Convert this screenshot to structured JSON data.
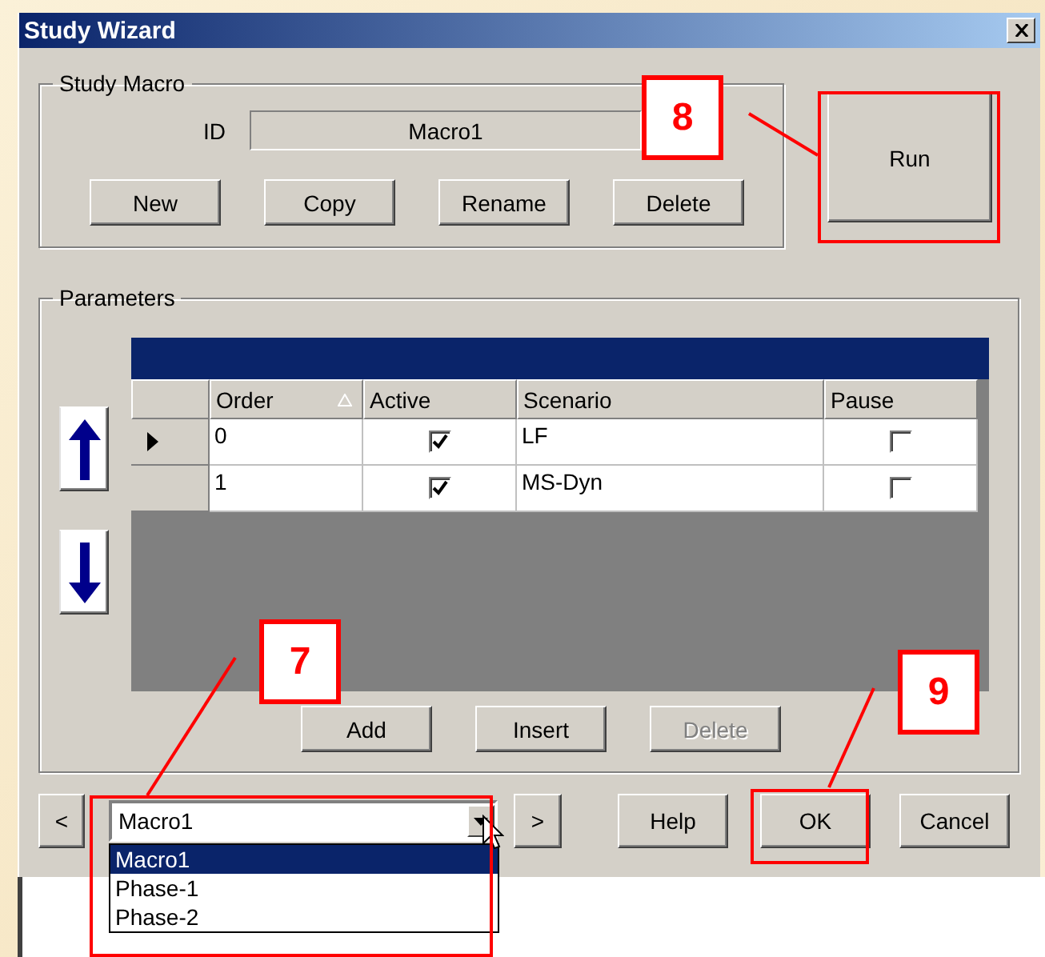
{
  "window": {
    "title": "Study Wizard"
  },
  "study_macro": {
    "label": "Study Macro",
    "id_label": "ID",
    "id_value": "Macro1",
    "buttons": [
      {
        "label": "New",
        "disabled": false
      },
      {
        "label": "Copy",
        "disabled": false
      },
      {
        "label": "Rename",
        "disabled": false
      },
      {
        "label": "Delete",
        "disabled": false
      }
    ]
  },
  "run_button": {
    "label": "Run"
  },
  "parameters": {
    "label": "Parameters",
    "columns": [
      {
        "label": "Order",
        "sorted": true
      },
      {
        "label": "Active",
        "sorted": false
      },
      {
        "label": "Scenario",
        "sorted": false
      },
      {
        "label": "Pause",
        "sorted": false
      }
    ],
    "rows": [
      {
        "current": true,
        "order": "0",
        "active": true,
        "scenario": "LF",
        "pause": false
      },
      {
        "current": false,
        "order": "1",
        "active": true,
        "scenario": "MS-Dyn",
        "pause": false
      }
    ],
    "buttons": [
      {
        "label": "Add",
        "disabled": false
      },
      {
        "label": "Insert",
        "disabled": false
      },
      {
        "label": "Delete",
        "disabled": true
      }
    ]
  },
  "nav": {
    "prev": "<",
    "next": ">"
  },
  "combo": {
    "value": "Macro1",
    "options": [
      {
        "label": "Macro1",
        "selected": true
      },
      {
        "label": "Phase-1",
        "selected": false
      },
      {
        "label": "Phase-2",
        "selected": false
      }
    ]
  },
  "buttons": [
    {
      "label": "Help"
    },
    {
      "label": "OK"
    },
    {
      "label": "Cancel"
    }
  ],
  "callouts": [
    {
      "label": "7"
    },
    {
      "label": "8"
    },
    {
      "label": "9"
    }
  ]
}
